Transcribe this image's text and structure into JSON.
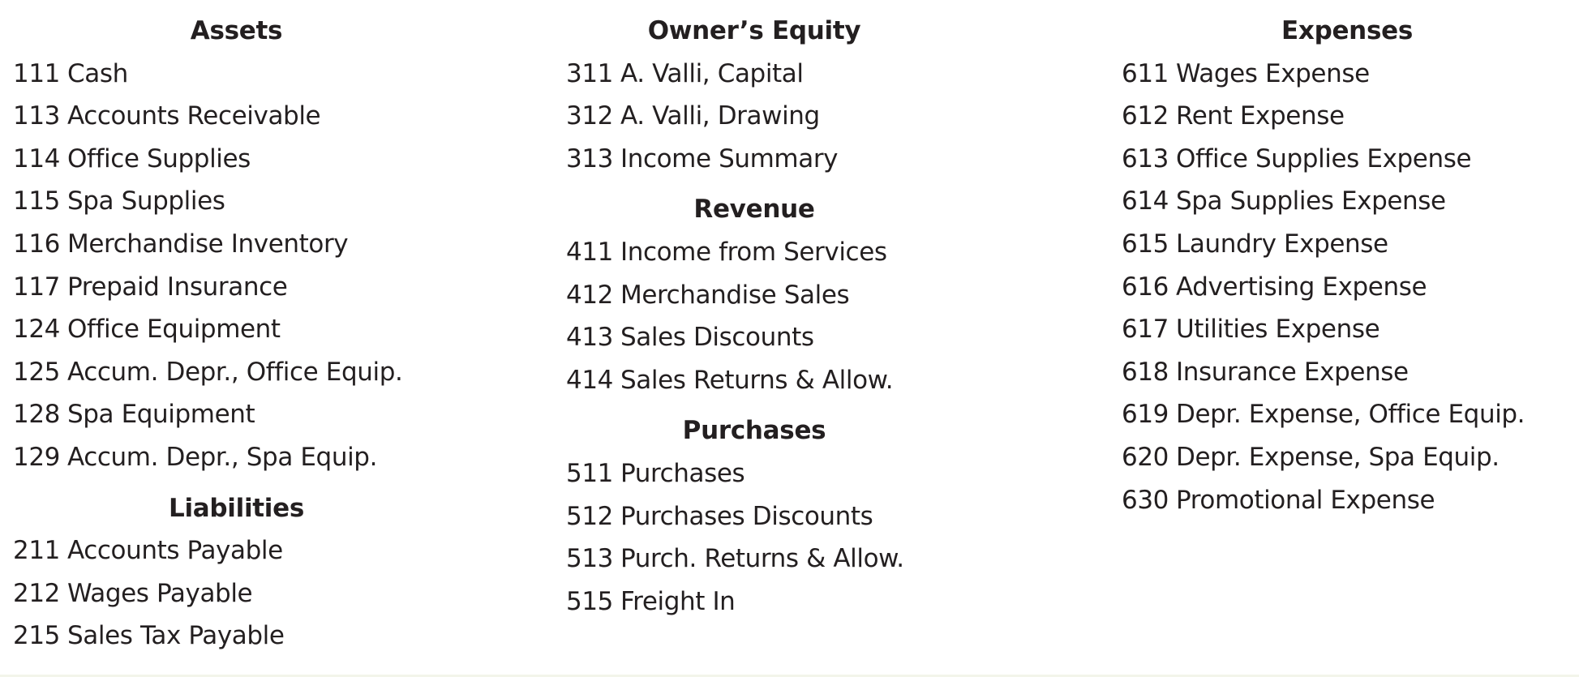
{
  "chart_of_accounts": {
    "columns": [
      {
        "sections": [
          {
            "title": "Assets",
            "accounts": [
              {
                "number": "111",
                "name": "Cash"
              },
              {
                "number": "113",
                "name": "Accounts Receivable"
              },
              {
                "number": "114",
                "name": "Office Supplies"
              },
              {
                "number": "115",
                "name": "Spa Supplies"
              },
              {
                "number": "116",
                "name": "Merchandise Inventory"
              },
              {
                "number": "117",
                "name": "Prepaid Insurance"
              },
              {
                "number": "124",
                "name": "Office Equipment"
              },
              {
                "number": "125",
                "name": "Accum. Depr., Office Equip."
              },
              {
                "number": "128",
                "name": "Spa Equipment"
              },
              {
                "number": "129",
                "name": "Accum. Depr., Spa Equip."
              }
            ]
          },
          {
            "title": "Liabilities",
            "accounts": [
              {
                "number": "211",
                "name": "Accounts Payable"
              },
              {
                "number": "212",
                "name": "Wages Payable"
              },
              {
                "number": "215",
                "name": "Sales Tax Payable"
              }
            ]
          }
        ]
      },
      {
        "sections": [
          {
            "title": "Owner’s Equity",
            "accounts": [
              {
                "number": "311",
                "name": "A. Valli, Capital"
              },
              {
                "number": "312",
                "name": "A. Valli, Drawing"
              },
              {
                "number": "313",
                "name": "Income Summary"
              }
            ]
          },
          {
            "title": "Revenue",
            "accounts": [
              {
                "number": "411",
                "name": "Income from Services"
              },
              {
                "number": "412",
                "name": "Merchandise Sales"
              },
              {
                "number": "413",
                "name": "Sales Discounts"
              },
              {
                "number": "414",
                "name": "Sales Returns & Allow."
              }
            ]
          },
          {
            "title": "Purchases",
            "accounts": [
              {
                "number": "511",
                "name": "Purchases"
              },
              {
                "number": "512",
                "name": "Purchases Discounts"
              },
              {
                "number": "513",
                "name": "Purch. Returns & Allow."
              },
              {
                "number": "515",
                "name": "Freight In"
              }
            ]
          }
        ]
      },
      {
        "sections": [
          {
            "title": "Expenses",
            "accounts": [
              {
                "number": "611",
                "name": "Wages Expense"
              },
              {
                "number": "612",
                "name": "Rent Expense"
              },
              {
                "number": "613",
                "name": "Office Supplies Expense"
              },
              {
                "number": "614",
                "name": "Spa Supplies Expense"
              },
              {
                "number": "615",
                "name": "Laundry Expense"
              },
              {
                "number": "616",
                "name": "Advertising Expense"
              },
              {
                "number": "617",
                "name": "Utilities Expense"
              },
              {
                "number": "618",
                "name": "Insurance Expense"
              },
              {
                "number": "619",
                "name": "Depr. Expense, Office Equip."
              },
              {
                "number": "620",
                "name": "Depr. Expense, Spa Equip."
              },
              {
                "number": "630",
                "name": "Promotional Expense"
              }
            ]
          }
        ]
      }
    ]
  },
  "colors": {
    "text": "#231f20",
    "background": "#ffffff",
    "bottom_strip": "#f3f5ea"
  }
}
